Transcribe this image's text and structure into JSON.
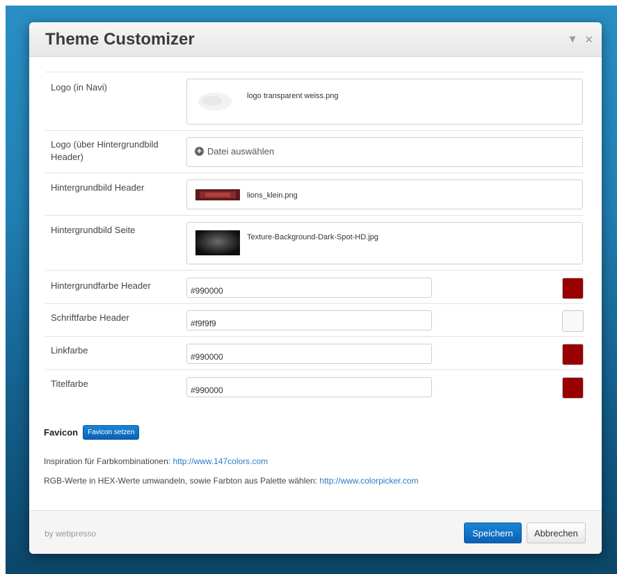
{
  "dialog": {
    "title": "Theme Customizer",
    "collapse_icon": "triangle-down-icon",
    "close_icon": "close-icon"
  },
  "rows": {
    "logo_navi": {
      "label": "Logo (in Navi)",
      "file": "logo transparent weiss.png"
    },
    "logo_header": {
      "label": "Logo (über Hintergrundbild Header)",
      "button": "Datei auswählen"
    },
    "bg_header": {
      "label": "Hintergrundbild Header",
      "file": "lions_klein.png"
    },
    "bg_page": {
      "label": "Hintergrundbild Seite",
      "file": "Texture-Background-Dark-Spot-HD.jpg"
    },
    "bgcolor_header": {
      "label": "Hintergrundfarbe Header",
      "value": "#990000"
    },
    "fontcolor_header": {
      "label": "Schriftfarbe Header",
      "value": "#f9f9f9"
    },
    "link_color": {
      "label": "Linkfarbe",
      "value": "#990000"
    },
    "title_color": {
      "label": "Titelfarbe",
      "value": "#990000"
    }
  },
  "favicon": {
    "label": "Favicon",
    "button": "Favicon setzen"
  },
  "info": {
    "inspiration_text": "Inspiration für Farbkombinationen:",
    "inspiration_link": "http://www.147colors.com",
    "rgb_text": "RGB-Werte in HEX-Werte umwandeln, sowie Farbton aus Palette wählen:",
    "rgb_link": "http://www.colorpicker.com"
  },
  "footer": {
    "note": "by webpresso",
    "save": "Speichern",
    "cancel": "Abbrechen"
  },
  "colors": {
    "accent": "#0b61b5",
    "link": "#2a7bc5"
  }
}
